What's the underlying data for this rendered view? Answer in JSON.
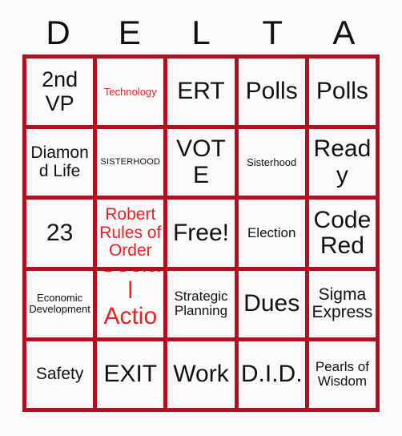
{
  "card": {
    "header_letters": [
      "D",
      "E",
      "L",
      "T",
      "A"
    ],
    "colors": {
      "grid_border": "#b0101f",
      "cell_background": "#fafafa",
      "page_background": "#fafafa",
      "text_black": "#111111",
      "text_red": "#ed2024"
    },
    "cells": [
      {
        "label": "2nd VP",
        "color": "black",
        "size": "lg"
      },
      {
        "label": "Technology",
        "color": "red",
        "size": "xs"
      },
      {
        "label": "ERT",
        "color": "black",
        "size": "xl"
      },
      {
        "label": "Polls",
        "color": "black",
        "size": "xl"
      },
      {
        "label": "Polls",
        "color": "black",
        "size": "xl"
      },
      {
        "label": "Diamond Life",
        "color": "black",
        "size": "md"
      },
      {
        "label": "SISTERHOOD",
        "color": "black",
        "size": "xxs"
      },
      {
        "label": "VOTE",
        "color": "black",
        "size": "xl"
      },
      {
        "label": "Sisterhood",
        "color": "black",
        "size": "xs"
      },
      {
        "label": "Ready",
        "color": "black",
        "size": "xl"
      },
      {
        "label": "23",
        "color": "black",
        "size": "xl"
      },
      {
        "label": "Robert Rules of Order",
        "color": "red",
        "size": "md"
      },
      {
        "label": "Free!",
        "color": "black",
        "size": "xl"
      },
      {
        "label": "Election",
        "color": "black",
        "size": "sm"
      },
      {
        "label": "Code Red",
        "color": "black",
        "size": "xl"
      },
      {
        "label": "Economic Development",
        "color": "black",
        "size": "xs"
      },
      {
        "label": "Social Action",
        "color": "red",
        "size": "xl"
      },
      {
        "label": "Strategic Planning",
        "color": "black",
        "size": "sm"
      },
      {
        "label": "Dues",
        "color": "black",
        "size": "xl"
      },
      {
        "label": "Sigma Express",
        "color": "black",
        "size": "md"
      },
      {
        "label": "Safety",
        "color": "black",
        "size": "md"
      },
      {
        "label": "EXIT",
        "color": "black",
        "size": "xl"
      },
      {
        "label": "Work",
        "color": "black",
        "size": "xl"
      },
      {
        "label": "D.I.D.",
        "color": "black",
        "size": "xl"
      },
      {
        "label": "Pearls of Wisdom",
        "color": "black",
        "size": "sm"
      }
    ]
  }
}
